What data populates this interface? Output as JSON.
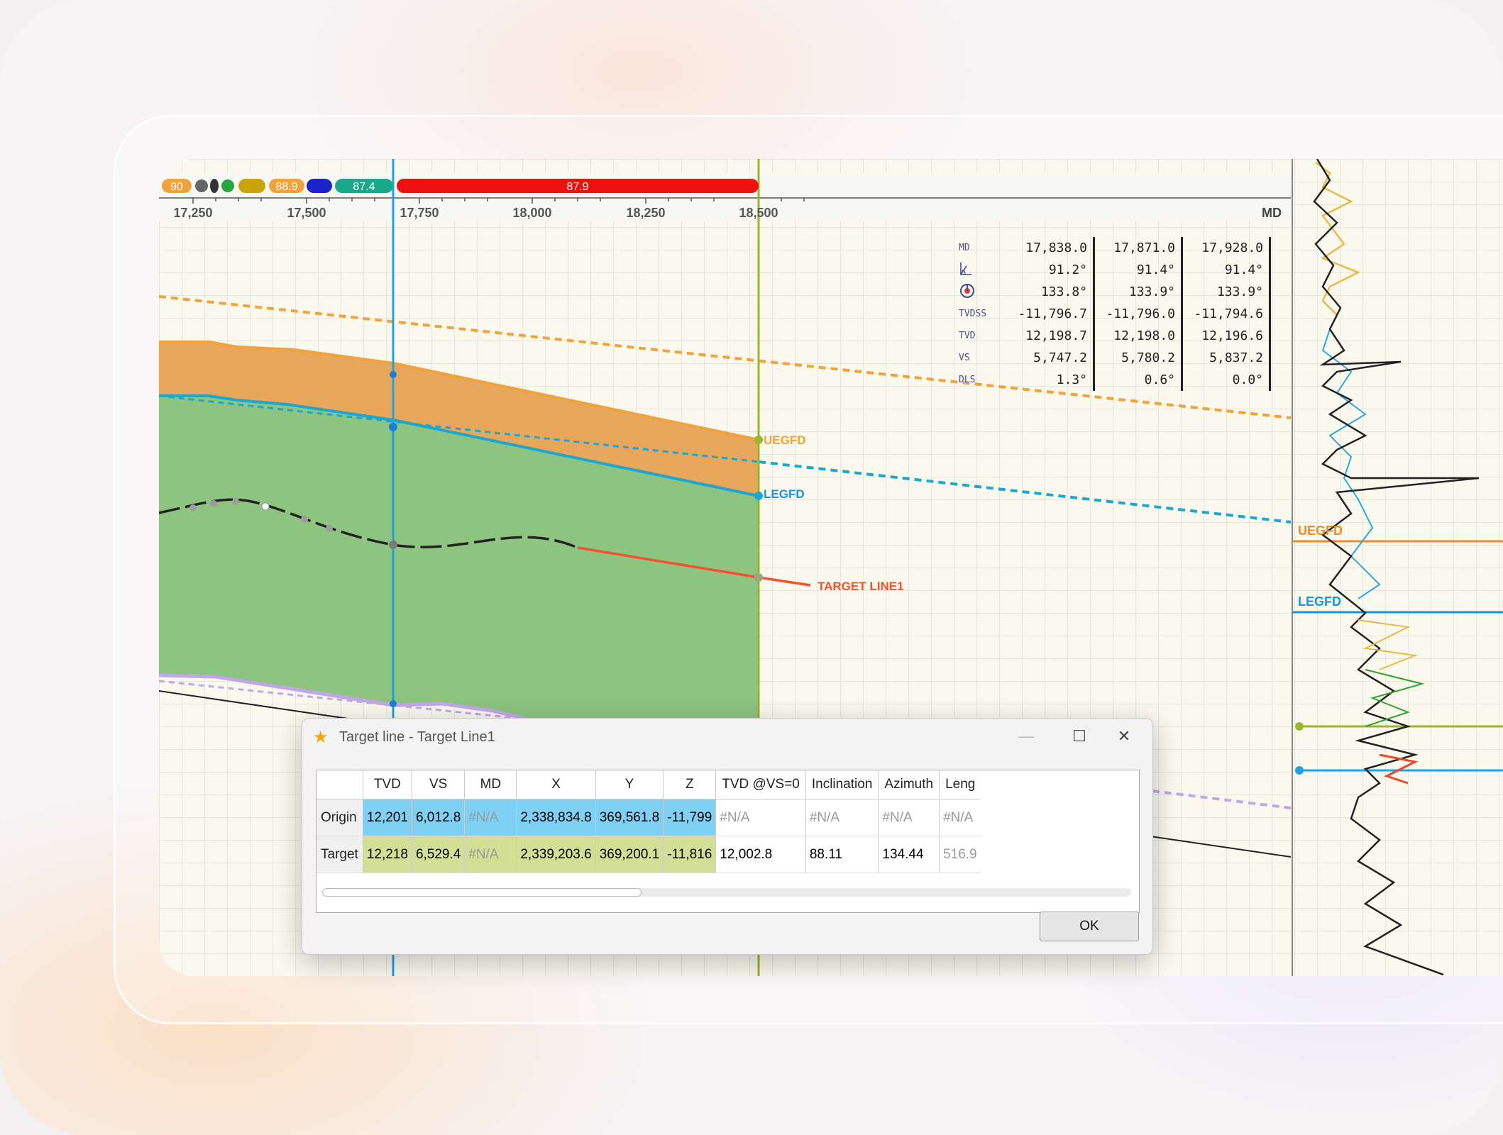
{
  "ruler": {
    "ticks": [
      "17,250",
      "17,500",
      "17,750",
      "18,000",
      "18,250",
      "18,500"
    ],
    "axis_label": "MD"
  },
  "badges": [
    "90",
    "88.9",
    "87.4",
    "87.9"
  ],
  "info_table": {
    "row_labels": [
      "MD",
      "",
      "",
      "TVDSS",
      "TVD",
      "VS",
      "DLS"
    ],
    "icons": [
      "inclination-icon",
      "azimuth-icon"
    ],
    "columns": [
      [
        "17,838.0",
        "91.2°",
        "133.8°",
        "-11,796.7",
        "12,198.7",
        "5,747.2",
        "1.3°"
      ],
      [
        "17,871.0",
        "91.4°",
        "133.9°",
        "-11,796.0",
        "12,198.0",
        "5,780.2",
        "0.6°"
      ],
      [
        "17,928.0",
        "91.4°",
        "133.9°",
        "-11,794.6",
        "12,196.6",
        "5,837.2",
        "0.0°"
      ]
    ]
  },
  "plot_labels": {
    "uegfd": "UEGFD",
    "legfd": "LEGFD",
    "target_line": "TARGET LINE1",
    "log_uegfd": "UEGFD",
    "log_legfd": "LEGFD"
  },
  "colors": {
    "orange_band": "#e7a85b",
    "green_band": "#8dc47f",
    "cursor_blue": "#1aa3e6",
    "marker_olive": "#9ab62a",
    "target_red": "#f2522c"
  },
  "dialog": {
    "title": "Target line - Target Line1",
    "columns": [
      "TVD",
      "VS",
      "MD",
      "X",
      "Y",
      "Z",
      "TVD @VS=0",
      "Inclination",
      "Azimuth",
      "Leng"
    ],
    "rows": [
      {
        "label": "Origin",
        "cells": [
          "12,201",
          "6,012.8",
          "#N/A",
          "2,338,834.8",
          "369,561.8",
          "-11,799",
          "#N/A",
          "#N/A",
          "#N/A",
          "#N/A"
        ]
      },
      {
        "label": "Target",
        "cells": [
          "12,218",
          "6,529.4",
          "#N/A",
          "2,339,203.6",
          "369,200.1",
          "-11,816",
          "12,002.8",
          "88.11",
          "134.44",
          "516.9"
        ]
      }
    ],
    "ok_label": "OK"
  }
}
